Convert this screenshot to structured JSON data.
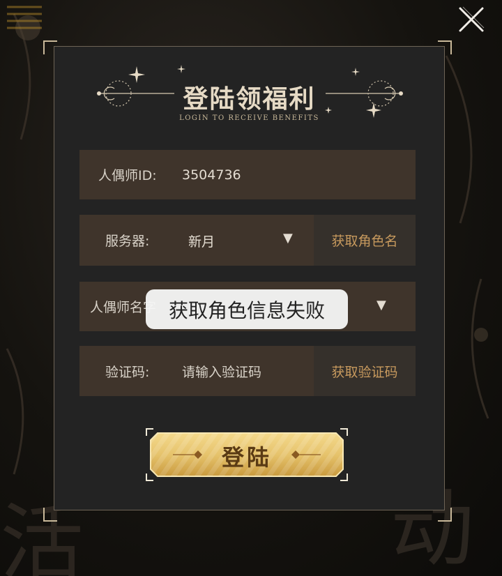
{
  "dialog": {
    "title": "登陆领福利",
    "subtitle": "LOGIN TO RECEIVE BENEFITS"
  },
  "form": {
    "player_id": {
      "label": "人偶师ID:",
      "value": "3504736"
    },
    "server": {
      "label": "服务器:",
      "value": "新月",
      "action": "获取角色名"
    },
    "role_name": {
      "label": "人偶师名字"
    },
    "captcha": {
      "label": "验证码:",
      "placeholder": "请输入验证码",
      "action": "获取验证码"
    }
  },
  "login_button": {
    "label": "登陆"
  },
  "toast": {
    "message": "获取角色信息失败"
  },
  "icons": {
    "close": "close-icon",
    "dropdown": "chevron-down-icon"
  },
  "colors": {
    "panel": "#232323",
    "field": "#3f342b",
    "accent": "#c89a5e",
    "gold": "#e6c36c"
  }
}
